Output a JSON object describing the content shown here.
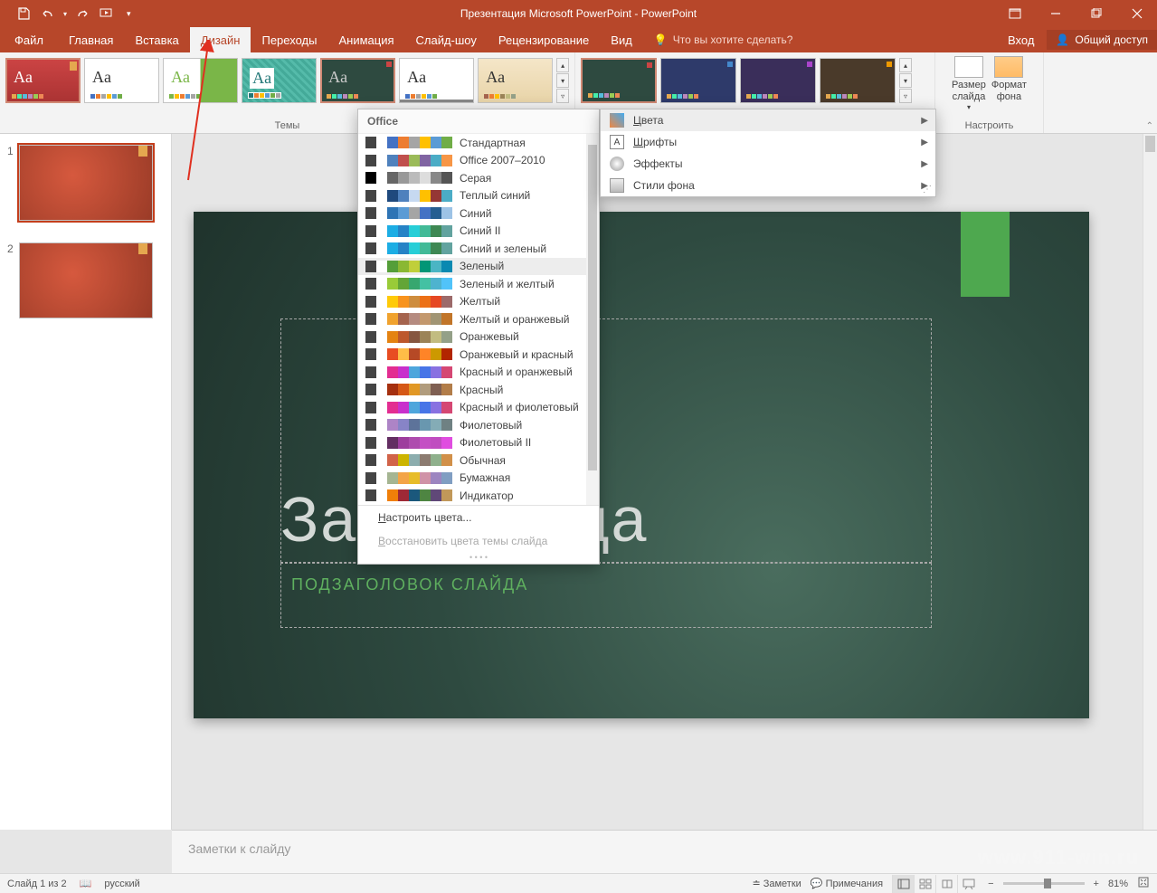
{
  "title": "Презентация Microsoft PowerPoint - PowerPoint",
  "tabs": {
    "file": "Файл",
    "home": "Главная",
    "insert": "Вставка",
    "design": "Дизайн",
    "transitions": "Переходы",
    "animations": "Анимация",
    "slideshow": "Слайд-шоу",
    "review": "Рецензирование",
    "view": "Вид",
    "tellme": "Что вы хотите сделать?",
    "signin": "Вход",
    "share": "Общий доступ"
  },
  "ribbon": {
    "themes_label": "Темы",
    "customize_label": "Настроить",
    "size_label": "Размер\nслайда",
    "format_label": "Формат\nфона"
  },
  "variants_menu": {
    "colors": "Цвета",
    "fonts": "Шрифты",
    "effects": "Эффекты",
    "bg_styles": "Стили фона"
  },
  "colors_menu": {
    "header": "Office",
    "items": [
      "Стандартная",
      "Office 2007–2010",
      "Серая",
      "Теплый синий",
      "Синий",
      "Синий II",
      "Синий и зеленый",
      "Зеленый",
      "Зеленый и желтый",
      "Желтый",
      "Желтый и оранжевый",
      "Оранжевый",
      "Оранжевый и красный",
      "Красный и оранжевый",
      "Красный",
      "Красный и фиолетовый",
      "Фиолетовый",
      "Фиолетовый II",
      "Обычная",
      "Бумажная",
      "Индикатор"
    ],
    "customize": "Настроить цвета...",
    "restore": "Восстановить цвета темы слайда"
  },
  "slide": {
    "title_text": "За             к слайда",
    "subtitle_text": "ПОДЗАГОЛОВОК СЛАЙДА"
  },
  "notes": {
    "placeholder": "Заметки к слайду"
  },
  "status": {
    "slide_info": "Слайд 1 из 2",
    "lang": "русский",
    "notes_btn": "Заметки",
    "comments_btn": "Примечания",
    "zoom": "81%"
  },
  "watermark": "www.911-win.ru",
  "swatch_palettes": [
    [
      "#444",
      "#fff",
      "#4472c4",
      "#ed7d31",
      "#a5a5a5",
      "#ffc000",
      "#5b9bd5",
      "#70ad47"
    ],
    [
      "#444",
      "#fff",
      "#4f81bd",
      "#c0504d",
      "#9bbb59",
      "#8064a2",
      "#4bacc6",
      "#f79646"
    ],
    [
      "#000",
      "#fff",
      "#666",
      "#999",
      "#bbb",
      "#ddd",
      "#888",
      "#555"
    ],
    [
      "#444",
      "#fff",
      "#1f497d",
      "#4f81bd",
      "#c6d9f1",
      "#ffc000",
      "#953735",
      "#4bacc6"
    ],
    [
      "#444",
      "#fff",
      "#2e74b5",
      "#5b9bd5",
      "#a5a5a5",
      "#4472c4",
      "#255e91",
      "#9dc3e6"
    ],
    [
      "#444",
      "#fff",
      "#1cade4",
      "#2683c6",
      "#27ced7",
      "#42ba97",
      "#3e8853",
      "#62a39f"
    ],
    [
      "#444",
      "#fff",
      "#1cade4",
      "#2683c6",
      "#27ced7",
      "#42ba97",
      "#3e8853",
      "#62a39f"
    ],
    [
      "#444",
      "#fff",
      "#549e39",
      "#8ab833",
      "#c0cf3a",
      "#029676",
      "#4ab5c4",
      "#0989b1"
    ],
    [
      "#444",
      "#fff",
      "#99cb38",
      "#63a537",
      "#37a76f",
      "#44c1a3",
      "#4eb3cf",
      "#51c3f9"
    ],
    [
      "#444",
      "#fff",
      "#ffca08",
      "#f8931d",
      "#ce8d3e",
      "#ec7016",
      "#e64823",
      "#9c6a6a"
    ],
    [
      "#444",
      "#fff",
      "#f0a22e",
      "#a5644e",
      "#b58b80",
      "#c3986d",
      "#a19574",
      "#c17529"
    ],
    [
      "#444",
      "#fff",
      "#e48312",
      "#bd582c",
      "#865640",
      "#9b8357",
      "#c2bc80",
      "#94a088"
    ],
    [
      "#444",
      "#fff",
      "#e84c22",
      "#ffbd47",
      "#b64926",
      "#ff8427",
      "#cc9900",
      "#b22600"
    ],
    [
      "#444",
      "#fff",
      "#e32d91",
      "#c830cc",
      "#4ea6dc",
      "#4775e7",
      "#8971e1",
      "#d54773"
    ],
    [
      "#444",
      "#fff",
      "#a5300f",
      "#d55816",
      "#e19825",
      "#b19c7d",
      "#7f5f52",
      "#b27d49"
    ],
    [
      "#444",
      "#fff",
      "#e32d91",
      "#c830cc",
      "#4ea6dc",
      "#4775e7",
      "#8971e1",
      "#d54773"
    ],
    [
      "#444",
      "#fff",
      "#ad84c6",
      "#8784c7",
      "#5d739a",
      "#6997af",
      "#84acb6",
      "#6f8183"
    ],
    [
      "#444",
      "#fff",
      "#632e62",
      "#9d3d9d",
      "#ae4cae",
      "#c450c4",
      "#c04dc0",
      "#e04de0"
    ],
    [
      "#444",
      "#fff",
      "#d16349",
      "#ccb400",
      "#8cadae",
      "#8c7b70",
      "#8fb08c",
      "#d19049"
    ],
    [
      "#444",
      "#fff",
      "#a5b592",
      "#f3a447",
      "#e7bc29",
      "#d092a7",
      "#9c85c0",
      "#809ec2"
    ],
    [
      "#444",
      "#fff",
      "#f07f09",
      "#9f2936",
      "#1b587c",
      "#4e8542",
      "#604878",
      "#c19859"
    ]
  ]
}
